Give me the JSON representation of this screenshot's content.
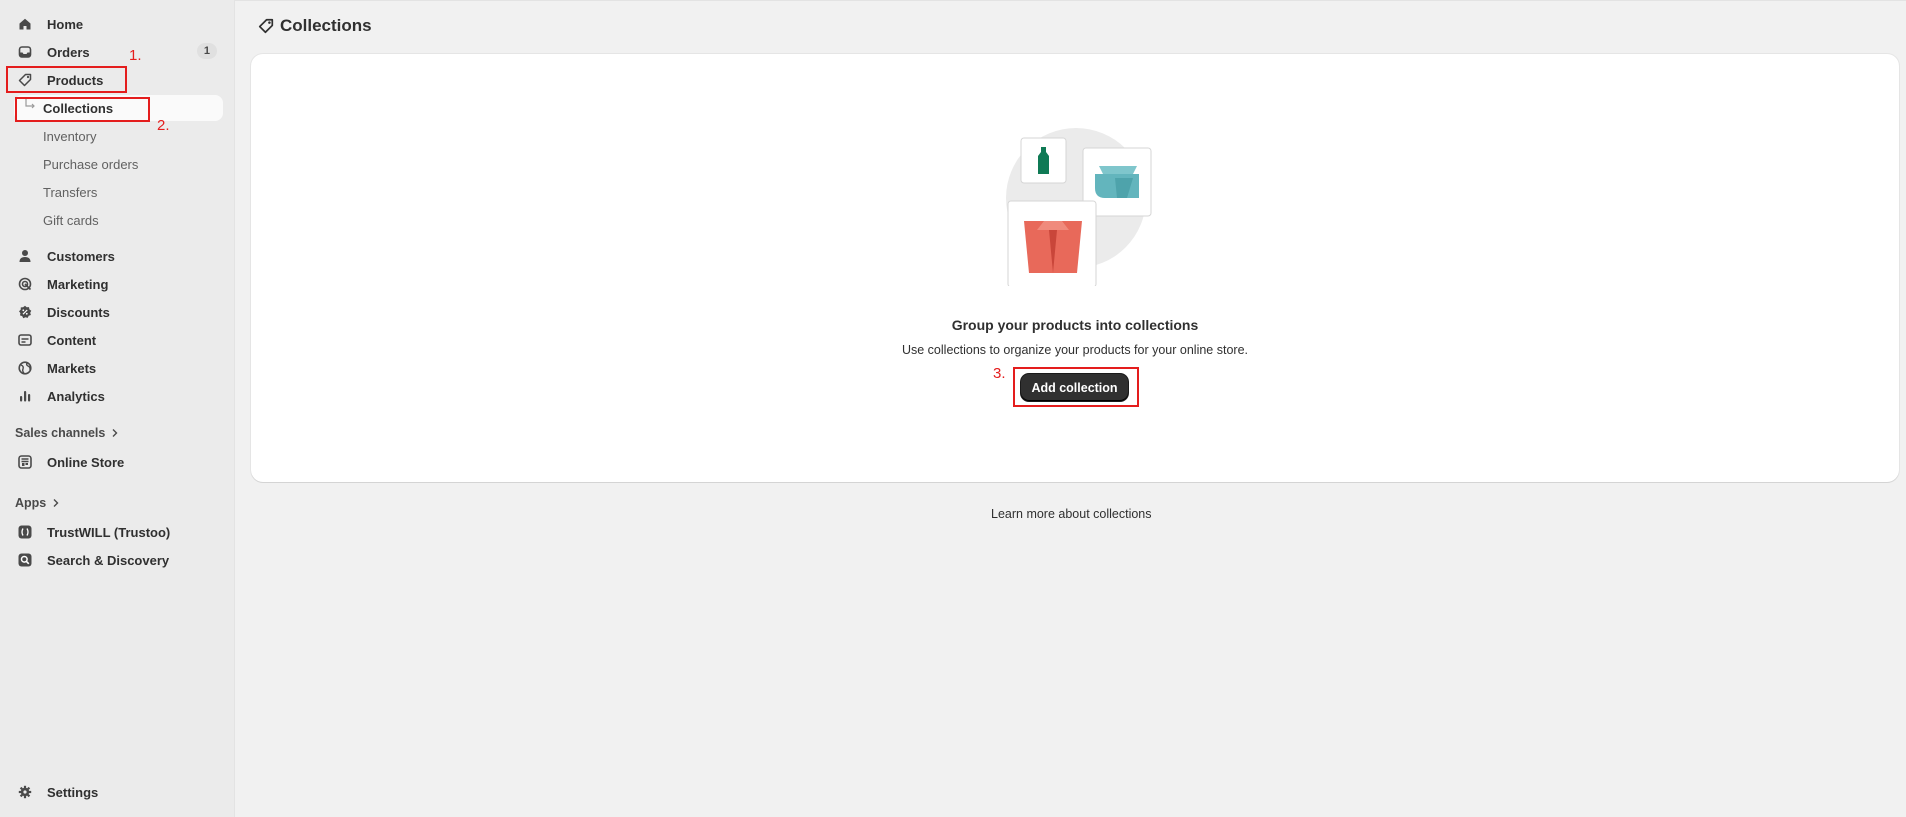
{
  "sidebar": {
    "home": "Home",
    "orders": "Orders",
    "orders_badge": "1",
    "products": "Products",
    "sub": [
      "Collections",
      "Inventory",
      "Purchase orders",
      "Transfers",
      "Gift cards"
    ],
    "customers": "Customers",
    "marketing": "Marketing",
    "discounts": "Discounts",
    "content": "Content",
    "markets": "Markets",
    "analytics": "Analytics",
    "sales_channels": "Sales channels",
    "online_store": "Online Store",
    "apps": "Apps",
    "trustwill": "TrustWILL (Trustoo)",
    "search_discovery": "Search & Discovery",
    "settings": "Settings"
  },
  "page": {
    "title": "Collections",
    "empty_title": "Group your products into collections",
    "empty_desc": "Use collections to organize your products for your online store.",
    "add_button": "Add collection",
    "learn_more": "Learn more about collections"
  },
  "annotations": [
    "1.",
    "2.",
    "3."
  ],
  "colors": {
    "accent_red": "#e41d1d",
    "primary_button": "#303030"
  },
  "icons": [
    "home-icon",
    "inbox-icon",
    "tag-icon",
    "person-icon",
    "target-icon",
    "discount-icon",
    "image-icon",
    "globe-icon",
    "bar-chart-icon",
    "store-icon",
    "app-icon",
    "search-icon",
    "gear-icon"
  ]
}
